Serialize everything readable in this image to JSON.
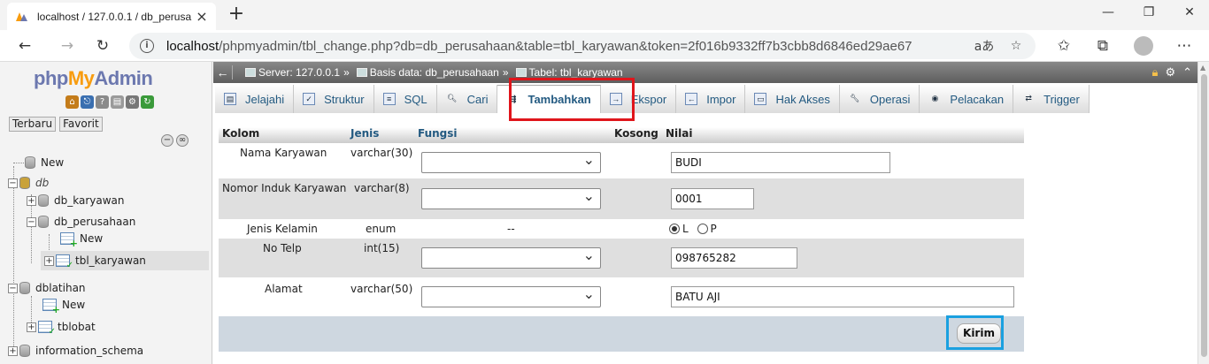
{
  "browser": {
    "tab_title": "localhost / 127.0.0.1 / db_perusa",
    "url_host": "localhost",
    "url_path": "/phpmyadmin/tbl_change.php?db=db_perusahaan&table=tbl_karyawan&token=2f016b9332ff7b3cbb8d6846ed29ae67",
    "read_aloud": "aあ"
  },
  "sidebar": {
    "logo_php": "php",
    "logo_my": "My",
    "logo_admin": "Admin",
    "tab_recent": "Terbaru",
    "tab_favorite": "Favorit",
    "tree": {
      "new": "New",
      "db": "db",
      "db_karyawan": "db_karyawan",
      "db_perusahaan": "db_perusahaan",
      "perusahaan_new": "New",
      "tbl_karyawan": "tbl_karyawan",
      "dblatihan": "dblatihan",
      "latihan_new": "New",
      "tblobat": "tblobat",
      "information_schema": "information_schema"
    }
  },
  "topbar": {
    "server": "Server: 127.0.0.1",
    "database": "Basis data: db_perusahaan",
    "table": "Tabel: tbl_karyawan"
  },
  "nav": {
    "tabs": [
      {
        "label": "Jelajahi",
        "icon": "browse-icon"
      },
      {
        "label": "Struktur",
        "icon": "structure-icon"
      },
      {
        "label": "SQL",
        "icon": "sql-icon"
      },
      {
        "label": "Cari",
        "icon": "search-icon"
      },
      {
        "label": "Tambahkan",
        "icon": "insert-icon"
      },
      {
        "label": "Ekspor",
        "icon": "export-icon"
      },
      {
        "label": "Impor",
        "icon": "import-icon"
      },
      {
        "label": "Hak Akses",
        "icon": "privileges-icon"
      },
      {
        "label": "Operasi",
        "icon": "operations-icon"
      },
      {
        "label": "Pelacakan",
        "icon": "tracking-icon"
      },
      {
        "label": "Trigger",
        "icon": "trigger-icon"
      }
    ],
    "active": "Tambahkan"
  },
  "form": {
    "headers": {
      "kolom": "Kolom",
      "jenis": "Jenis",
      "fungsi": "Fungsi",
      "kosong": "Kosong",
      "nilai": "Nilai"
    },
    "rows": [
      {
        "kolom": "Nama Karyawan",
        "jenis": "varchar(30)",
        "value": "BUDI"
      },
      {
        "kolom": "Nomor Induk Karyawan",
        "jenis": "varchar(8)",
        "value": "0001"
      },
      {
        "kolom": "Jenis Kelamin",
        "jenis": "enum",
        "fungsi": "--",
        "option_l": "L",
        "option_p": "P",
        "selected": "L"
      },
      {
        "kolom": "No Telp",
        "jenis": "int(15)",
        "value": "098765282"
      },
      {
        "kolom": "Alamat",
        "jenis": "varchar(50)",
        "value": "BATU AJI"
      }
    ],
    "submit_label": "Kirim"
  },
  "colors": {
    "highlight_red": "#e0151b",
    "highlight_blue": "#1aa0e0",
    "link_blue": "#235a81"
  }
}
